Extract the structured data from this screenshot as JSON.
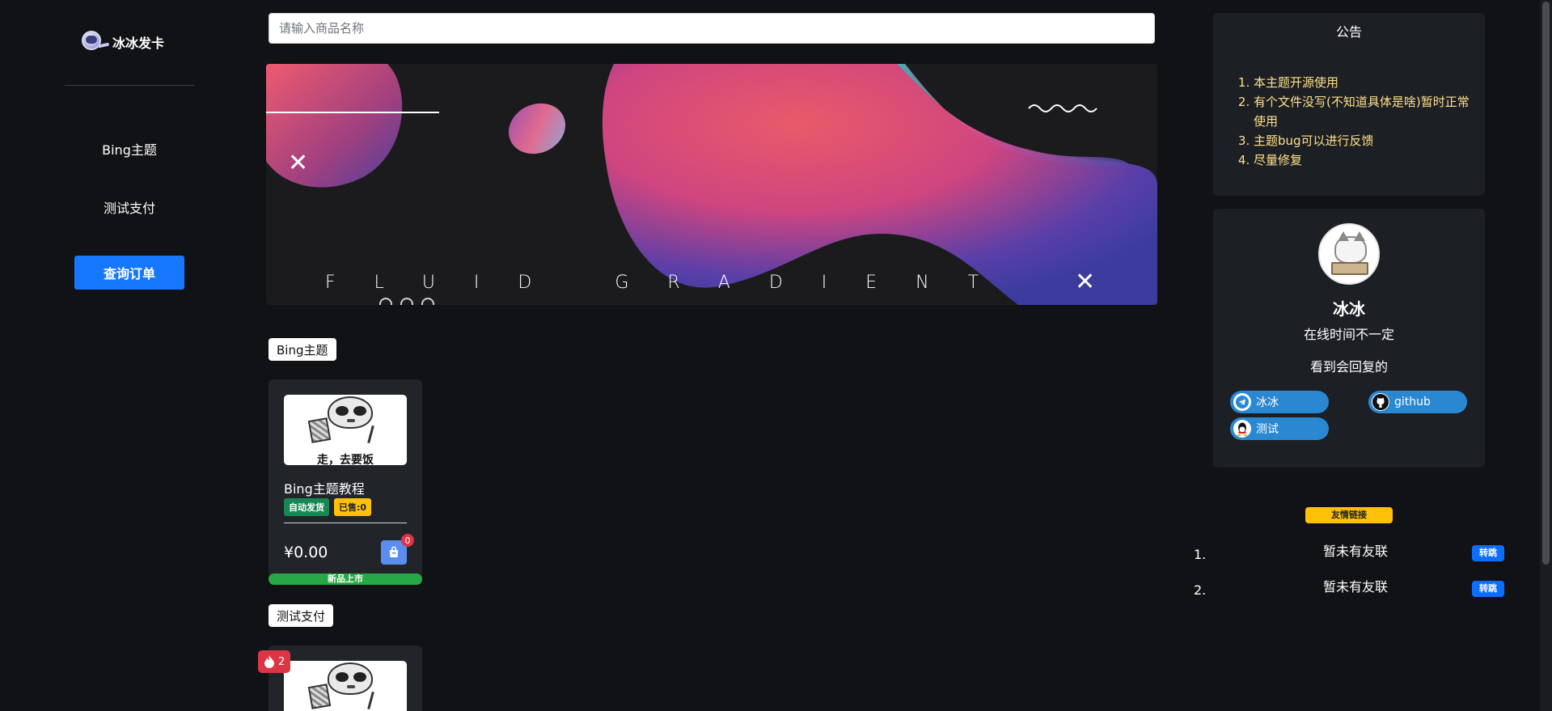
{
  "brand": {
    "name": "冰冰发卡",
    "logo_icon": "astronaut-logo-icon"
  },
  "sidebar": {
    "items": [
      {
        "label": "Bing主题"
      },
      {
        "label": "测试支付"
      }
    ],
    "query_button": "查询订单"
  },
  "search": {
    "placeholder": "请输入商品名称",
    "value": ""
  },
  "banner": {
    "text": "FLUID GRADIENT",
    "slides": 3
  },
  "categories": [
    {
      "label": "Bing主题",
      "products": [
        {
          "image_caption": "走，去要饭",
          "title": "Bing主题教程",
          "tags": [
            "自动发货",
            "已售:0"
          ],
          "price": "¥0.00",
          "cart_count": "0",
          "ribbon": "新品上市"
        }
      ]
    },
    {
      "label": "测试支付",
      "products": [
        {
          "hot_count": "2"
        }
      ]
    }
  ],
  "notice": {
    "title": "公告",
    "items": [
      "本主题开源使用",
      "有个文件没写(不知道具体是啥)暂时正常使用",
      "主题bug可以进行反馈",
      "尽量修复"
    ]
  },
  "profile": {
    "name": "冰冰",
    "line1": "在线时间不一定",
    "line2": "看到会回复的",
    "socials": [
      {
        "label": "冰冰",
        "icon": "telegram-icon"
      },
      {
        "label": "github",
        "icon": "github-icon"
      },
      {
        "label": "测试",
        "icon": "qq-icon"
      }
    ]
  },
  "friends": {
    "title": "友情链接",
    "items": [
      {
        "num": "1.",
        "name": "暂未有友联",
        "jump": "转跳"
      },
      {
        "num": "2.",
        "name": "暂未有友联",
        "jump": "转跳"
      }
    ]
  },
  "colors": {
    "background": "#111215",
    "primary": "#1677ff",
    "notice_text": "#ffe08a",
    "social": "#2a88d3",
    "badge_yellow": "#ffc107",
    "success": "#198754",
    "danger": "#dc3545"
  }
}
